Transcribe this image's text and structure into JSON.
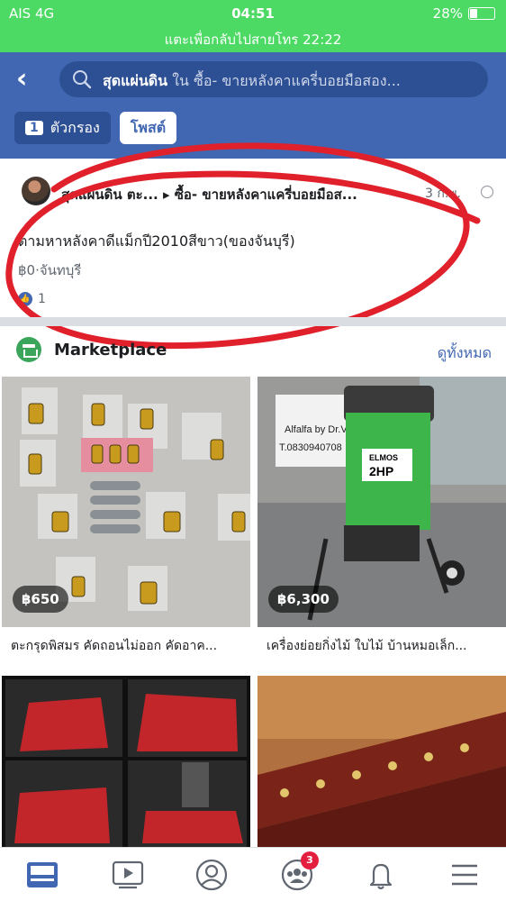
{
  "status_bar": {
    "carrier": "AIS  4G",
    "time": "04:51",
    "battery": "28%",
    "battery_level": 0.28,
    "call_banner": "แตะเพื่อกลับไปสายโทร 22:22"
  },
  "search": {
    "query": "สุดแผ่นดิน",
    "scope": " ใน ซื้อ- ขายหลังคาแครี่บอยมือสอง..."
  },
  "chips": {
    "filter_count": "1",
    "filter_label": "ตัวกรอง",
    "posts_label": "โพสต์"
  },
  "post": {
    "title": "สุดแผ่นดิน ตะ... ▸ ซื้อ- ขายหลังคาแครี่บอยมือส...",
    "date": "3 ก.พ.",
    "body": "ตามหาหลังคาดีแม็กปี2010สีขาว(ของจันบุรี)",
    "meta": "฿0·จันทบุรี",
    "reactions": "1"
  },
  "marketplace": {
    "title": "Marketplace",
    "see_all": "ดูทั้งหมด",
    "items": [
      {
        "price": "฿650",
        "caption": "ตะกรุดพิสมร คัดถอนไม่ออก คัดอาค..."
      },
      {
        "price": "฿6,300",
        "caption": "เครื่องย่อยกิ่งไม้ ใบไม้ บ้านหมอเล็ก..."
      },
      {
        "price": "",
        "caption": ""
      },
      {
        "price": "",
        "caption": ""
      }
    ],
    "photo_text": {
      "sign_line1": "Alfalfa by Dr.Vet",
      "sign_line2": "T.0830940708",
      "machine_brand": "ELMOS",
      "machine_power": "2HP"
    }
  },
  "tabbar": {
    "groups_badge": "3"
  },
  "colors": {
    "header": "#4267b2",
    "status_bar": "#4cd964",
    "annotation_circle": "#e0202a",
    "badge": "#e41e3f"
  }
}
